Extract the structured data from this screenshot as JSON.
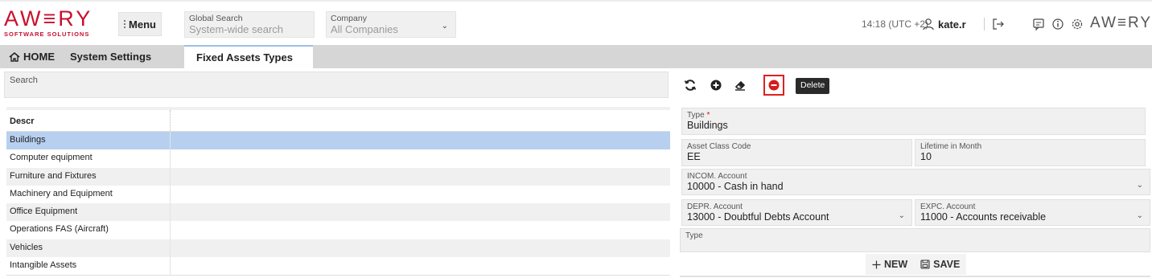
{
  "header": {
    "logo_word": "AW≡RY",
    "logo_sub": "SOFTWARE SOLUTIONS",
    "menu_label": "Menu",
    "global_search": {
      "label": "Global Search",
      "placeholder": "System-wide search"
    },
    "company": {
      "label": "Company",
      "value": "All Companies"
    },
    "time": "14:18 (UTC +2)",
    "user": "kate.r",
    "brand_right": "AW≡RY"
  },
  "tabs": [
    {
      "label": "HOME"
    },
    {
      "label": "System Settings"
    },
    {
      "label": "Fixed Assets Types"
    }
  ],
  "search": {
    "label": "Search"
  },
  "grid": {
    "column": "Descr",
    "rows": [
      "Buildings",
      "Computer equipment",
      "Furniture and Fixtures",
      "Machinery and Equipment",
      "Office Equipment",
      "Operations FAS (Aircraft)",
      "Vehicles",
      "Intangible Assets"
    ],
    "selected_index": 0
  },
  "toolbar": {
    "tooltip": "Delete"
  },
  "form": {
    "type": {
      "label": "Type",
      "required_mark": "*",
      "value": "Buildings"
    },
    "asset_class_code": {
      "label": "Asset Class Code",
      "value": "EE"
    },
    "lifetime": {
      "label": "Lifetime in Month",
      "value": "10"
    },
    "incom_account": {
      "label": "INCOM. Account",
      "value": "10000 - Cash in hand"
    },
    "depr_account": {
      "label": "DEPR. Account",
      "value": "13000 - Doubtful Debts Account"
    },
    "expc_account": {
      "label": "EXPC. Account",
      "value": "11000 - Accounts receivable"
    },
    "type_note": {
      "label": "Type",
      "value": ""
    }
  },
  "actions": {
    "new_label": "NEW",
    "save_label": "SAVE"
  },
  "colors": {
    "brand": "#c8102e",
    "selected_row": "#b8d0f0",
    "delete_highlight": "#e02020"
  }
}
